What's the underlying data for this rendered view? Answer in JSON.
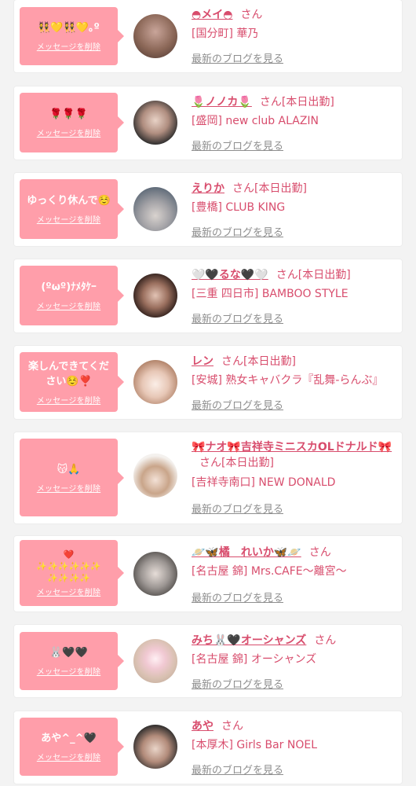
{
  "entries": [
    {
      "bubble_text": "👯💛👯💛｡º",
      "delete_label": "メッセージを削除",
      "name": "◓メイ◓",
      "suffix": "さん",
      "shop": "[国分町] 華乃",
      "blog_label": "最新のブログを見る",
      "avatar_colors": [
        "#6b4a3f",
        "#c9a59a"
      ]
    },
    {
      "bubble_text": "🌹🌹🌹",
      "delete_label": "メッセージを削除",
      "name": "🌷ノノカ🌷",
      "suffix": "さん[本日出勤]",
      "shop": "[盛岡] new club ALAZIN",
      "blog_label": "最新のブログを見る",
      "avatar_colors": [
        "#2b2b2b",
        "#e8d2c6"
      ]
    },
    {
      "bubble_text": "ゆっくり休んで☺️",
      "delete_label": "メッセージを削除",
      "name": "えりか",
      "suffix": "さん[本日出勤]",
      "shop": "[豊橋] CLUB KING",
      "blog_label": "最新のブログを見る",
      "avatar_colors": [
        "#7c8794",
        "#d9d3cf"
      ]
    },
    {
      "bubble_text": "(ºωº)ﾅﾒﾀｹｰ",
      "delete_label": "メッセージを削除",
      "name": "🤍🖤るな🖤🤍",
      "suffix": "さん[本日出勤]",
      "shop": "[三重 四日市] BAMBOO STYLE",
      "blog_label": "最新のブログを見る",
      "avatar_colors": [
        "#3a2520",
        "#d9b7a8"
      ]
    },
    {
      "bubble_text": "楽しんできてくだ\nさい☺️❣️",
      "delete_label": "メッセージを削除",
      "name": "レン",
      "suffix": "さん[本日出勤]",
      "shop": "[安城] 熟女キャバクラ『乱舞-らんぶ』",
      "blog_label": "最新のブログを見る",
      "avatar_colors": [
        "#b98a6e",
        "#f3e1d6"
      ]
    },
    {
      "bubble_text": "😽🙏",
      "delete_label": "メッセージを削除",
      "name": "🎀ナオ🎀吉祥寺ミニスカOLドナルド🎀",
      "suffix": "さん[本日出勤]",
      "shop": "[吉祥寺南口] NEW DONALD",
      "blog_label": "最新のブログを見る",
      "avatar_colors": [
        "#f4f1ee",
        "#a9784f"
      ]
    },
    {
      "bubble_text": "❤️\n✨✨✨✨✨✨\n✨✨✨✨",
      "delete_label": "メッセージを削除",
      "name": "🪐🦋橘　れいか🦋🪐",
      "suffix": "さん",
      "shop": "[名古屋 錦] Mrs.CAFE〜離宮〜",
      "blog_label": "最新のブログを見る",
      "avatar_colors": [
        "#6e6a66",
        "#d8d3cf"
      ]
    },
    {
      "bubble_text": "🐰🖤🖤",
      "delete_label": "メッセージを削除",
      "name": "みち🐰🖤オーシャンズ",
      "suffix": "さん",
      "shop": "[名古屋 錦] オーシャンズ",
      "blog_label": "最新のブログを見る",
      "avatar_colors": [
        "#d9cabd",
        "#f6e8e1"
      ]
    },
    {
      "bubble_text": "あや^_^🖤",
      "delete_label": "メッセージを削除",
      "name": "あや",
      "suffix": "さん",
      "shop": "[本厚木] Girls Bar NOEL",
      "blog_label": "最新のブログを見る",
      "avatar_colors": [
        "#2a2a2a",
        "#e9d4c8"
      ]
    }
  ]
}
